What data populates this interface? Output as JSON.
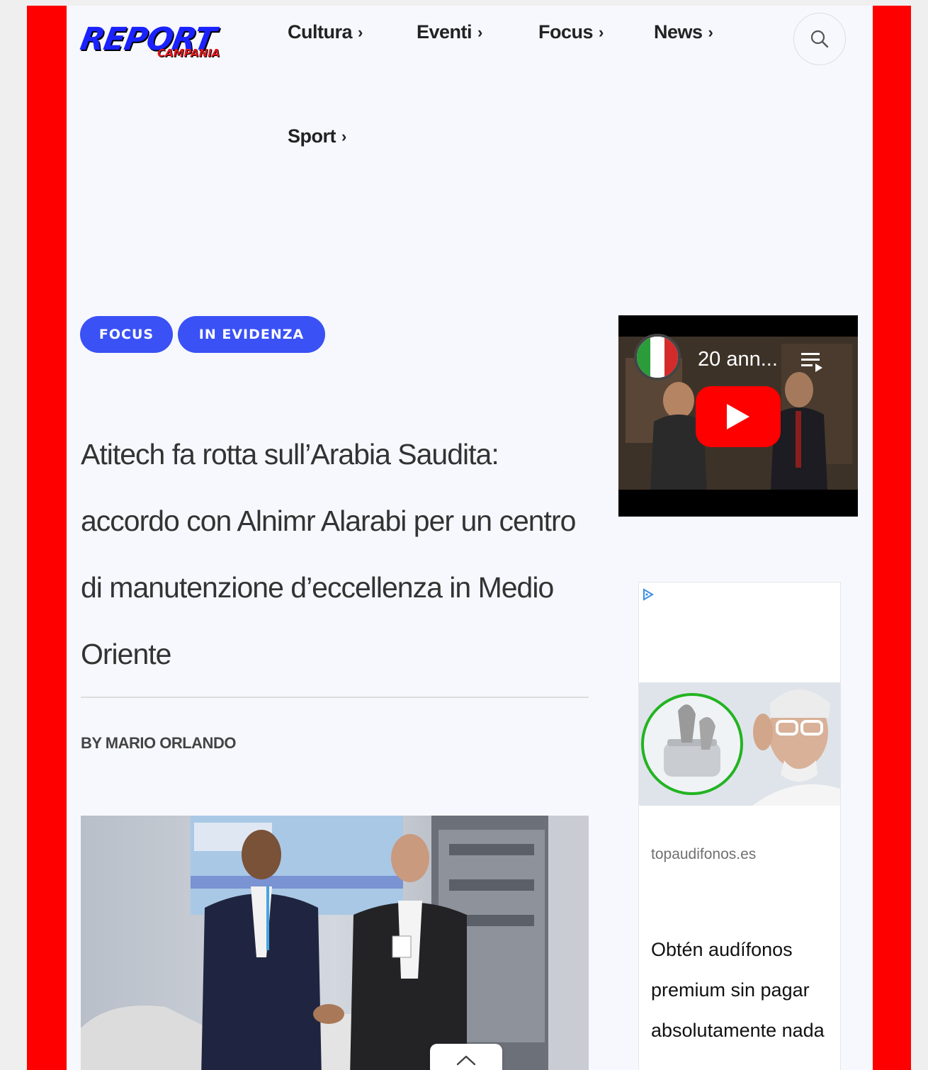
{
  "site": {
    "logo_main": "REPORT",
    "logo_sub": "CAMPANIA"
  },
  "nav": {
    "items": [
      {
        "label": "Cultura"
      },
      {
        "label": "Eventi"
      },
      {
        "label": "Focus"
      },
      {
        "label": "News"
      },
      {
        "label": "Sport"
      }
    ],
    "chevron": "›",
    "search_icon": "search-icon"
  },
  "article": {
    "tags": [
      "FOCUS",
      "IN EVIDENZA"
    ],
    "title": "Atitech fa rotta sull’Arabia Saudita: accordo con Alnimr Alarabi per un centro di manutenzione d’eccellenza in Medio Oriente",
    "byline_prefix": "BY",
    "byline_author": "MARIO ORLANDO"
  },
  "video": {
    "title": "20 ann..."
  },
  "ad": {
    "domain": "topaudifonos.es",
    "text": "Obtén audífonos premium sin pagar absolutamente nada"
  },
  "colors": {
    "accent": "#3a51f5",
    "frame": "#ff0000",
    "logo_blue": "#1a22ff",
    "youtube_red": "#ff0000"
  }
}
